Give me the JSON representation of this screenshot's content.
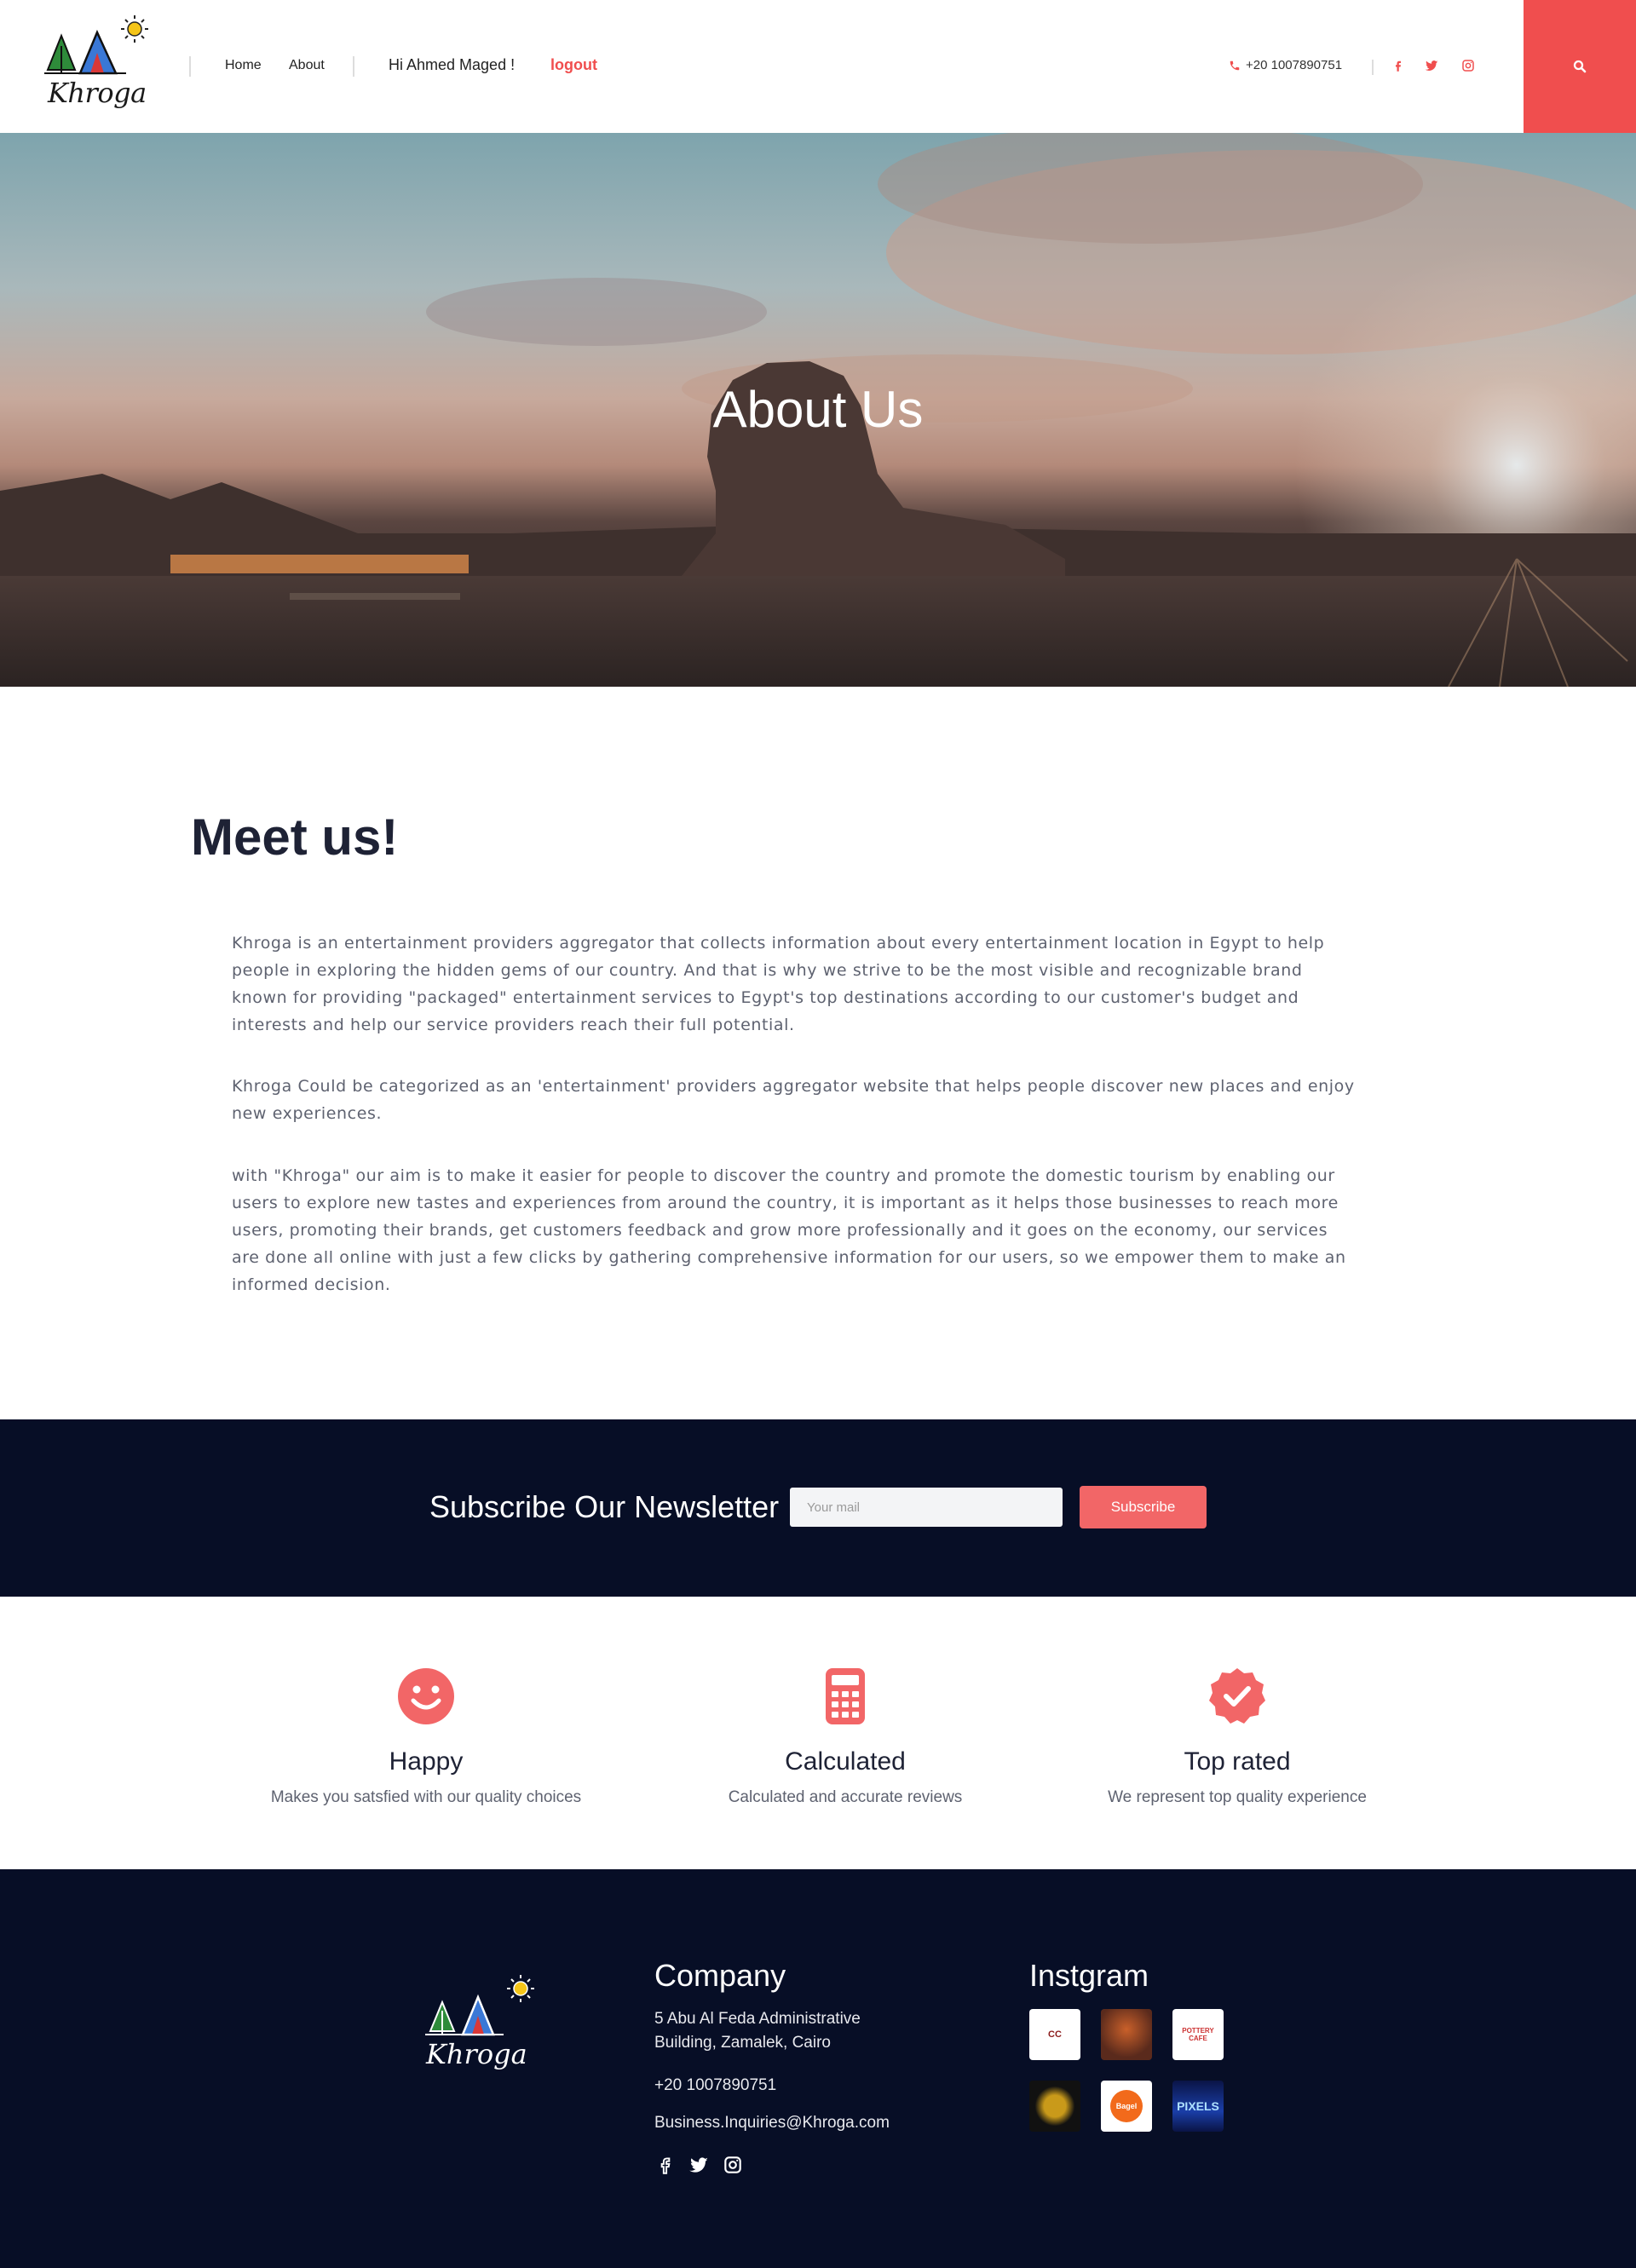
{
  "header": {
    "brand": "Khroga",
    "nav": [
      {
        "label": "Home"
      },
      {
        "label": "About"
      }
    ],
    "greeting": "Hi Ahmed Maged !",
    "logout_label": "logout",
    "phone": "+20 1007890751",
    "social_icons": [
      "facebook-icon",
      "twitter-icon",
      "instagram-icon"
    ],
    "accent_color": "#f04e4e"
  },
  "hero": {
    "title": "About Us"
  },
  "meet": {
    "title": "Meet us!",
    "paragraphs": [
      "Khroga is an entertainment providers aggregator that collects information about every entertainment location in Egypt to help people in exploring the hidden gems of our country. And that is why we strive to be the most visible and recognizable brand known for providing \"packaged\" entertainment services to Egypt's top destinations according to our customer's budget and interests and help our service providers reach their full potential.",
      "Khroga Could be categorized as an 'entertainment' providers aggregator website that helps people discover new places and enjoy new experiences.",
      "with \"Khroga\" our aim is to make it easier for people to discover the country and promote the domestic tourism by enabling our users to explore new tastes and experiences from around the country, it is important as it helps those businesses to reach more users, promoting their brands, get customers feedback and grow more professionally and it goes on the economy, our services are done all online with just a few clicks by gathering comprehensive information for our users, so we empower them to make an informed decision."
    ]
  },
  "newsletter": {
    "title": "Subscribe Our Newsletter",
    "input_placeholder": "Your mail",
    "button_label": "Subscribe"
  },
  "features": [
    {
      "icon": "smiley-icon",
      "title": "Happy",
      "desc": "Makes you satsfied with our quality choices"
    },
    {
      "icon": "calculator-icon",
      "title": "Calculated",
      "desc": "Calculated and accurate reviews"
    },
    {
      "icon": "verified-badge-icon",
      "title": "Top rated",
      "desc": "We represent top quality experience"
    }
  ],
  "footer": {
    "brand": "Khroga",
    "company": {
      "title": "Company",
      "address": "5 Abu Al Feda Administrative Building, Zamalek, Cairo",
      "phone": "+20 1007890751",
      "email": "Business.Inquiries@Khroga.com"
    },
    "instagram": {
      "title": "Instgram",
      "tiles": [
        {
          "label": "CC"
        },
        {
          "label": ""
        },
        {
          "label": "POTTERY CAFE"
        },
        {
          "label": ""
        },
        {
          "label": "Bagel"
        },
        {
          "label": "PIXELS"
        }
      ]
    },
    "background_color": "#070e26"
  }
}
